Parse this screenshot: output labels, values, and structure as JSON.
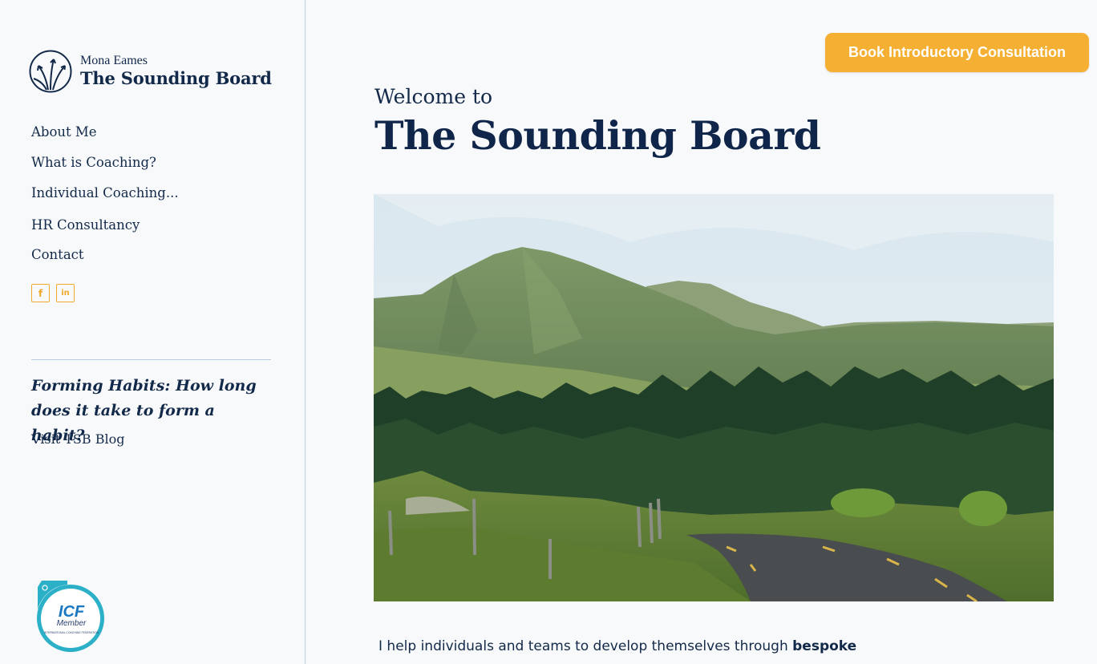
{
  "brand": {
    "owner": "Mona Eames",
    "name": "The Sounding Board"
  },
  "nav": {
    "items": [
      {
        "label": "About Me"
      },
      {
        "label": "What is Coaching?"
      },
      {
        "label": "Individual Coaching..."
      },
      {
        "label": "HR Consultancy"
      },
      {
        "label": "Contact"
      }
    ]
  },
  "social": {
    "facebook_glyph": "f",
    "linkedin_glyph": "in",
    "accent": "#f0a92e"
  },
  "blog": {
    "title": "Forming Habits: How long does it take to form a habit?",
    "link": "Visit TSB Blog"
  },
  "badge": {
    "abbr": "ICF",
    "label": "Member",
    "org": "INTERNATIONAL COACHING FEDERATION"
  },
  "header": {
    "cta_label": "Book Introductory Consultation",
    "cta_color": "#f5b033"
  },
  "hero": {
    "welcome": "Welcome to",
    "title": "The Sounding Board"
  },
  "intro": {
    "text": "I help individuals and teams to develop themselves through ",
    "bold": "bespoke"
  },
  "colors": {
    "navy": "#12294a",
    "border": "#b9cde0",
    "background": "#f8f9fa"
  }
}
